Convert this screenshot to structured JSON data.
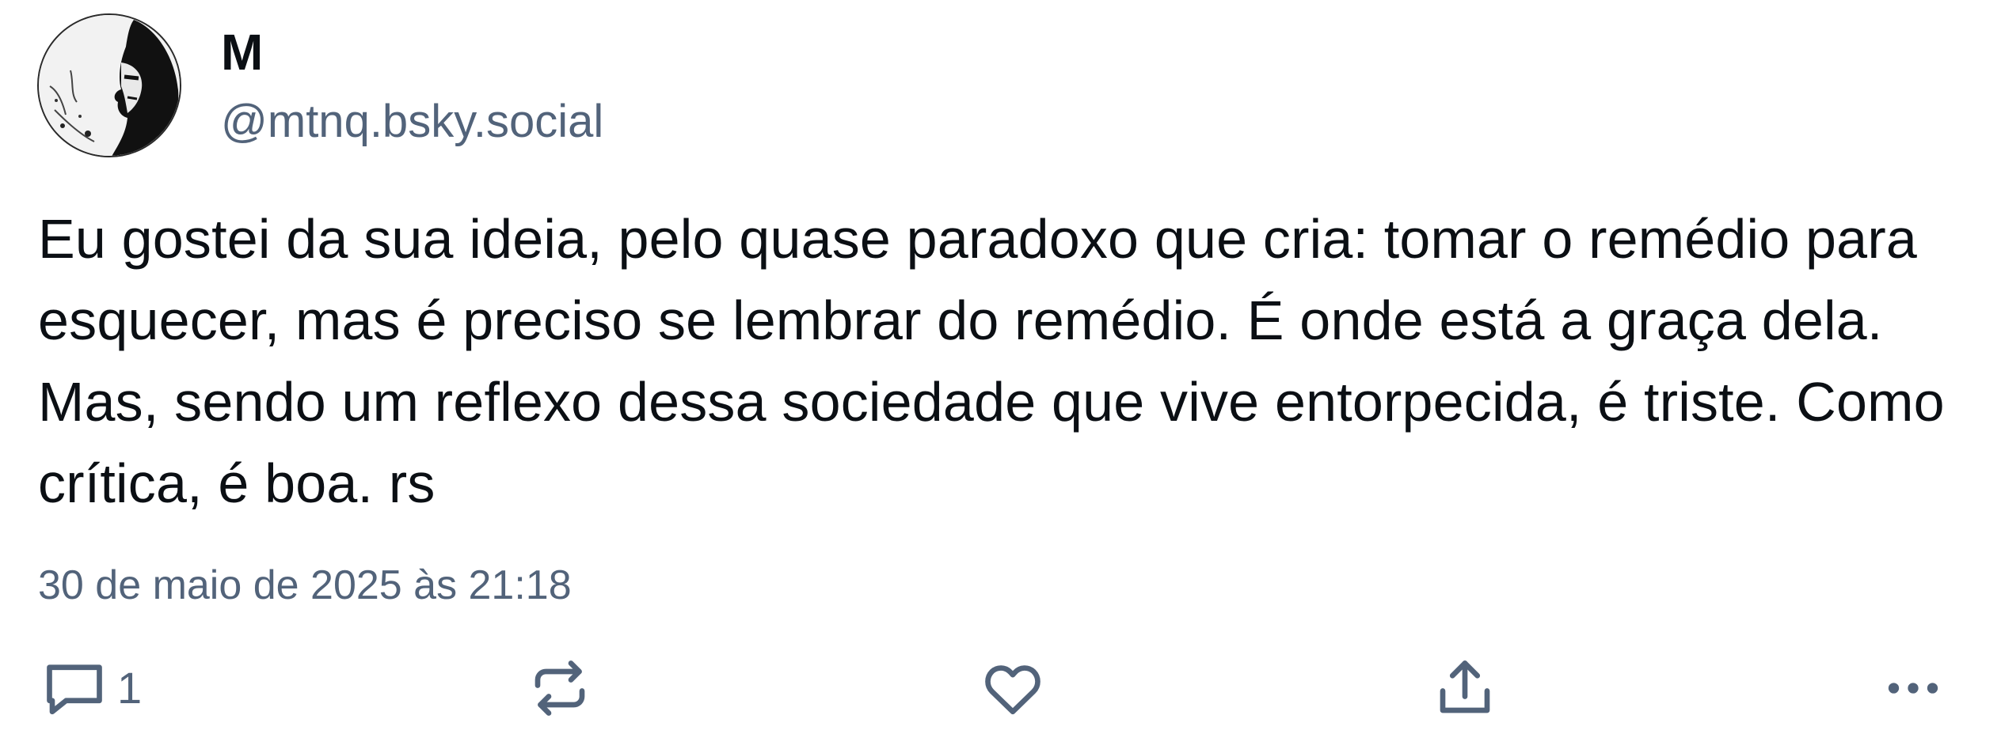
{
  "author": {
    "display_name": "M",
    "handle": "@mtnq.bsky.social",
    "avatar_icon": "avatar-portrait-icon"
  },
  "post": {
    "text": "Eu gostei da sua ideia, pelo quase paradoxo que cria: tomar o remédio para esquecer, mas é preciso se lembrar do remédio. É onde está a graça dela. Mas, sendo um reflexo dessa sociedade que vive entorpecida, é triste. Como crítica, é boa. rs",
    "timestamp": "30 de maio de 2025 às 21:18"
  },
  "actions": {
    "reply": {
      "icon": "reply-icon",
      "count": "1"
    },
    "repost": {
      "icon": "repost-icon"
    },
    "like": {
      "icon": "heart-icon"
    },
    "share": {
      "icon": "share-icon"
    },
    "more": {
      "icon": "more-options-icon"
    }
  },
  "colors": {
    "text": "#0b0f14",
    "muted": "#52637a",
    "background": "#ffffff"
  }
}
